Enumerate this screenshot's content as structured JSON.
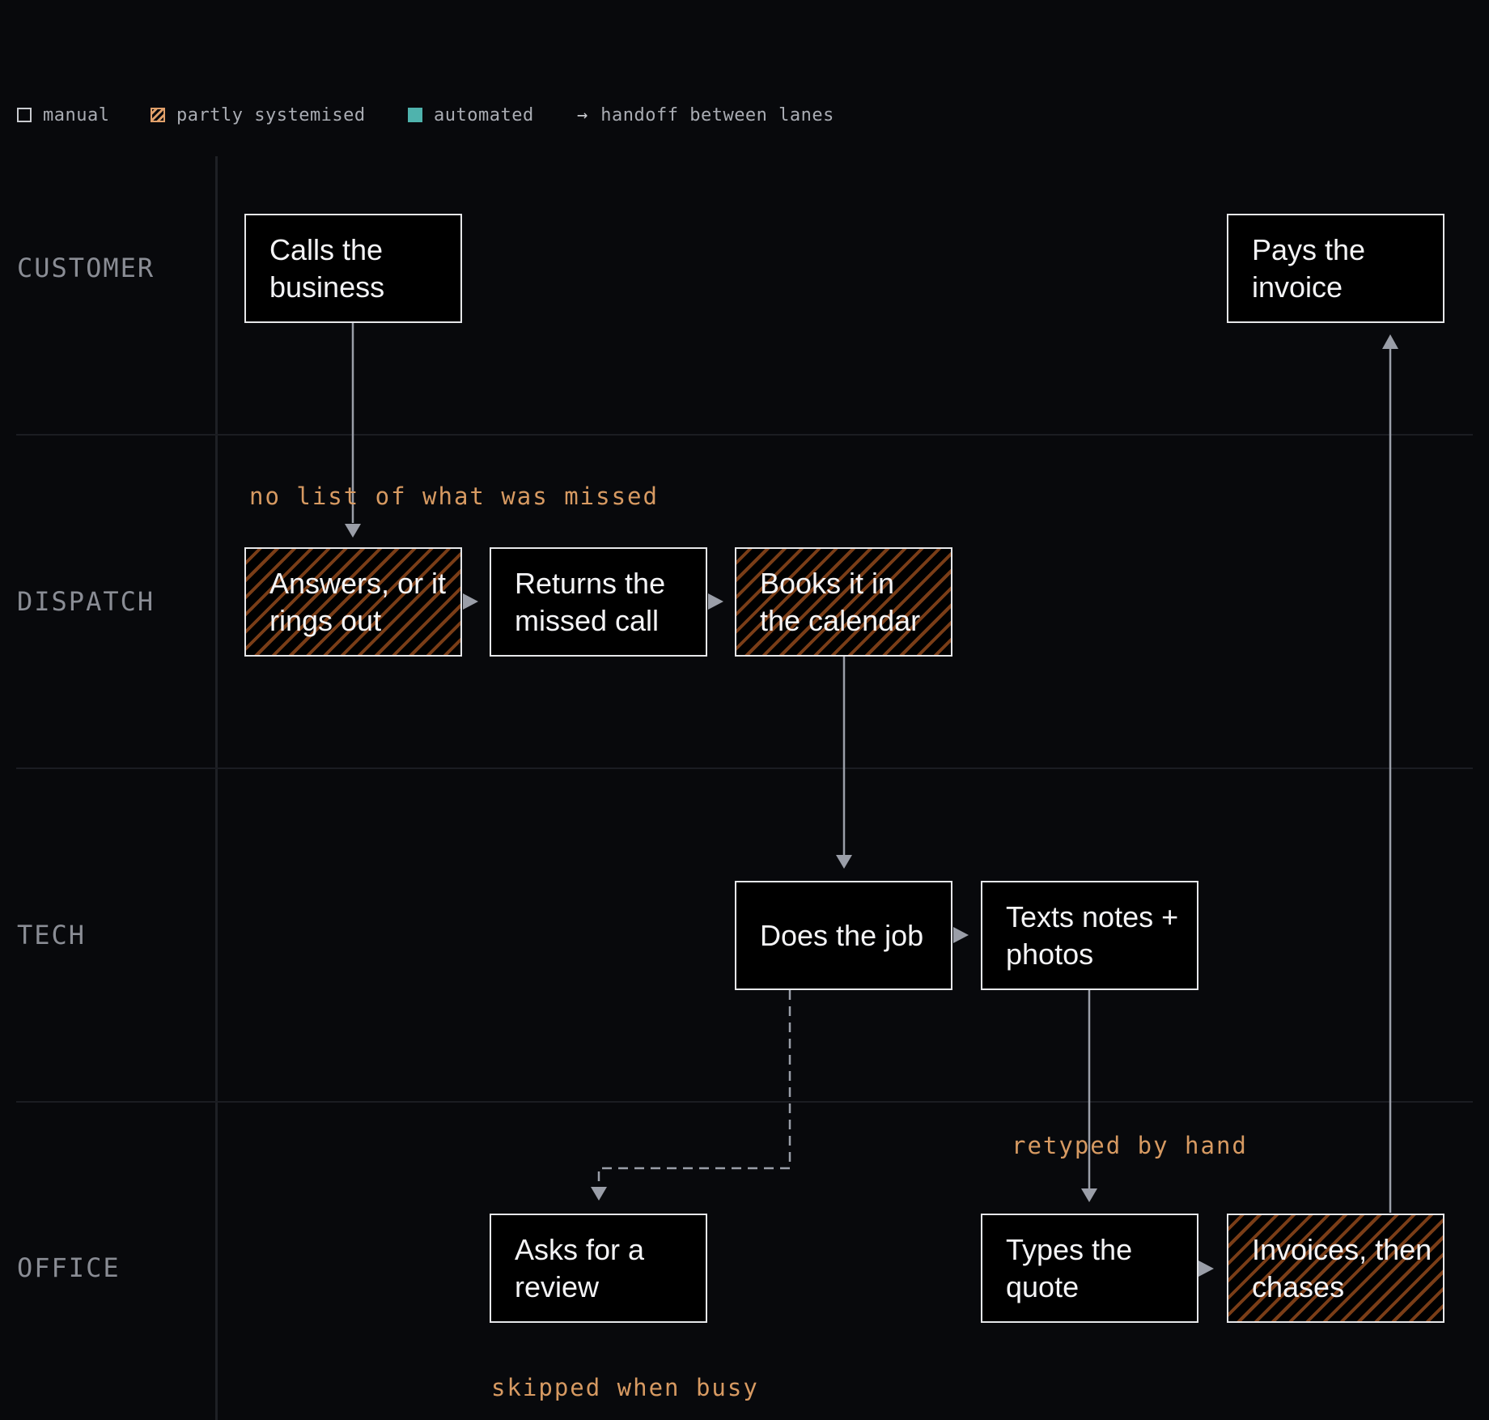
{
  "legend": {
    "manual": "manual",
    "partial": "partly systemised",
    "automated": "automated",
    "handoff_arrow": "→",
    "handoff": "handoff between lanes"
  },
  "lanes": {
    "customer": "CUSTOMER",
    "dispatch": "DISPATCH",
    "tech": "TECH",
    "office": "OFFICE"
  },
  "steps": {
    "calls": {
      "label": "Calls the business",
      "status": "manual"
    },
    "pays": {
      "label": "Pays the invoice",
      "status": "manual"
    },
    "answers": {
      "label": "Answers, or it rings out",
      "status": "partly systemised"
    },
    "returns": {
      "label": "Returns the missed call",
      "status": "manual"
    },
    "books": {
      "label": "Books it in the calendar",
      "status": "partly systemised"
    },
    "does_job": {
      "label": "Does the job",
      "status": "manual"
    },
    "texts": {
      "label": "Texts notes + photos",
      "status": "manual"
    },
    "review": {
      "label": "Asks for a review",
      "status": "manual"
    },
    "types_quote": {
      "label": "Types the quote",
      "status": "manual"
    },
    "invoices": {
      "label": "Invoices, then chases",
      "status": "partly systemised"
    }
  },
  "notes": {
    "missed": "no list of what was missed",
    "retyped": "retyped by hand",
    "skipped": "skipped when busy"
  },
  "colors": {
    "background": "#08090c",
    "box_border": "#e6e7ea",
    "hatch": "#7a3d17",
    "note": "#d79a62",
    "connector": "#9a9ea8",
    "automated": "#4fb3ad"
  }
}
